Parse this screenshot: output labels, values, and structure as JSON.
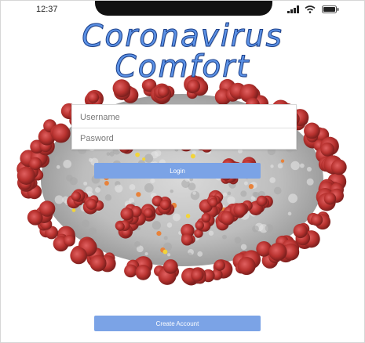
{
  "status_bar": {
    "time": "12:37",
    "icons": [
      "signal-icon",
      "wifi-icon",
      "battery-icon"
    ]
  },
  "app": {
    "title_line1": "Coronavirus",
    "title_line2": "Comfort"
  },
  "login_form": {
    "username_placeholder": "Username",
    "password_placeholder": "Pasword",
    "login_label": "Login"
  },
  "footer": {
    "create_account_label": "Create Account"
  },
  "colors": {
    "title": "#5b91e5",
    "button": "#7ba3e6",
    "virus_spike": "#b8322f",
    "virus_body": "#c9c9c9"
  }
}
